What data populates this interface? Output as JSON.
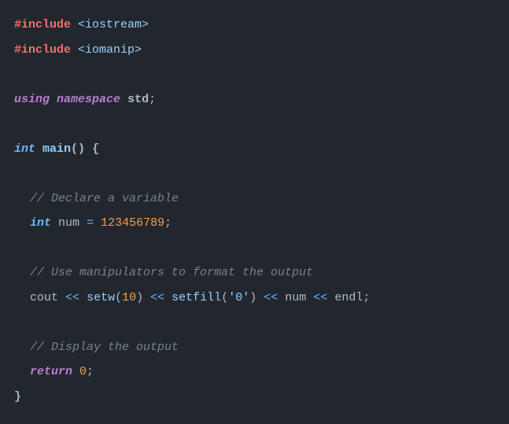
{
  "code": {
    "l1": {
      "preproc": "#include",
      "sp": " ",
      "path": "<iostream>"
    },
    "l2": {
      "preproc": "#include",
      "sp": " ",
      "path": "<iomanip>"
    },
    "l3": {
      "kw1": "using",
      "sp1": " ",
      "kw2": "namespace",
      "sp2": " ",
      "ns": "std",
      "semi": ";"
    },
    "l4": {
      "type": "int",
      "sp1": " ",
      "fn": "main",
      "paren": "()",
      "sp2": " ",
      "brace": "{"
    },
    "l5": {
      "text": "// Declare a variable"
    },
    "l6": {
      "type": "int",
      "sp1": " ",
      "var": "num",
      "sp2": " ",
      "eq": "=",
      "sp3": " ",
      "num": "123456789",
      "semi": ";"
    },
    "l7": {
      "text": "// Use manipulators to format the output"
    },
    "l8": {
      "cout": "cout",
      "sp1": " ",
      "op1": "<<",
      "sp2": " ",
      "fn1": "setw",
      "po1": "(",
      "n1": "10",
      "pc1": ")",
      "sp3": " ",
      "op2": "<<",
      "sp4": " ",
      "fn2": "setfill",
      "po2": "(",
      "ch": "'0'",
      "pc2": ")",
      "sp5": " ",
      "op3": "<<",
      "sp6": " ",
      "var": "num",
      "sp7": " ",
      "op4": "<<",
      "sp8": " ",
      "endl": "endl",
      "semi": ";"
    },
    "l9": {
      "text": "// Display the output"
    },
    "l10": {
      "kw": "return",
      "sp": " ",
      "num": "0",
      "semi": ";"
    },
    "l11": {
      "brace": "}"
    }
  }
}
